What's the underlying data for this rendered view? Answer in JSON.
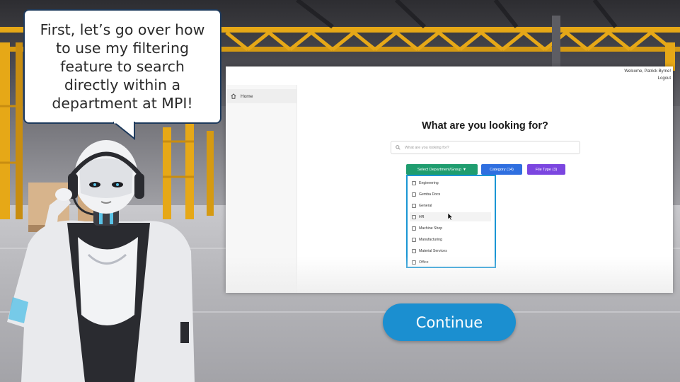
{
  "speech_bubble": {
    "text": "First, let’s go over how to use my filtering feature to search directly within a department at MPI!"
  },
  "app": {
    "header": {
      "welcome": "Welcome, Patrick Byrne!",
      "logout": "Logout"
    },
    "sidebar": {
      "items": [
        {
          "label": "Home",
          "icon": "home-icon"
        }
      ]
    },
    "main": {
      "headline": "What are you looking for?",
      "search_placeholder": "What are you looking for?",
      "filters": {
        "department": "Select Department/Group ▼",
        "category": "Category (14)",
        "file_type": "File Type (3)"
      },
      "department_options": [
        "Engineering",
        "Gemba Docs",
        "General",
        "HR",
        "Machine Shop",
        "Manufacturing",
        "Material Services",
        "Office"
      ]
    }
  },
  "continue_label": "Continue",
  "colors": {
    "department_button": "#1f9d6f",
    "category_button": "#2f6fe0",
    "file_type_button": "#7b46e0",
    "dropdown_border": "#1a96d4",
    "continue_button": "#1b8fd0",
    "bubble_border": "#1e3a5c",
    "beam_yellow": "#e6a817"
  }
}
